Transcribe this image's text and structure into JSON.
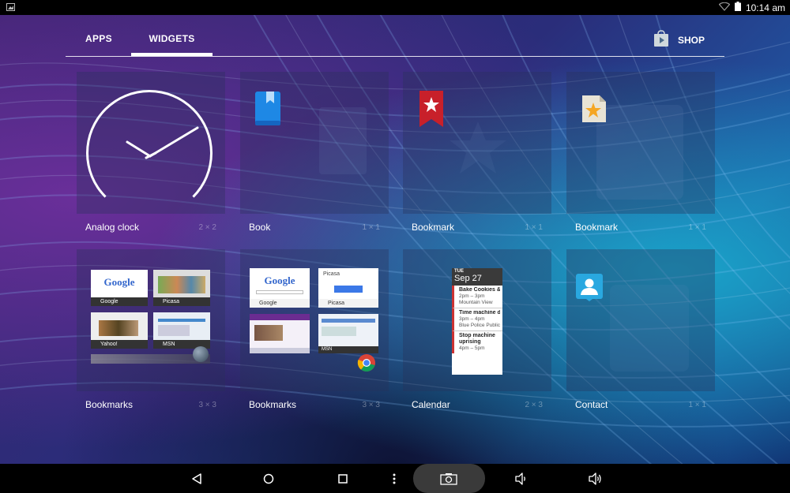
{
  "status_bar": {
    "time": "10:14 am",
    "icons": [
      "image-notification-icon",
      "wifi-icon",
      "battery-icon"
    ]
  },
  "tabs": [
    {
      "label": "APPS",
      "active": false
    },
    {
      "label": "WIDGETS",
      "active": true
    }
  ],
  "shop": {
    "label": "SHOP",
    "icon": "play-store-icon"
  },
  "widgets": [
    {
      "label": "Analog clock",
      "size": "2 × 2",
      "icon": "analog-clock"
    },
    {
      "label": "Book",
      "size": "1 × 1",
      "icon": "book-icon"
    },
    {
      "label": "Bookmark",
      "size": "1 × 1",
      "icon": "bookmark-ribbon-icon"
    },
    {
      "label": "Bookmark",
      "size": "1 × 1",
      "icon": "bookmark-star-icon"
    },
    {
      "label": "Bookmarks",
      "size": "3 × 3",
      "icon": "bookmarks-preview"
    },
    {
      "label": "Bookmarks",
      "size": "3 × 3",
      "icon": "bookmarks-preview"
    },
    {
      "label": "Calendar",
      "size": "2 × 3",
      "icon": "calendar-preview"
    },
    {
      "label": "Contact",
      "size": "1 × 1",
      "icon": "contact-icon"
    }
  ],
  "bookmarks_preview_1": {
    "tiles": [
      "Google",
      "Picasa",
      "Yahoo!",
      "MSN"
    ]
  },
  "bookmarks_preview_2": {
    "tiles": [
      "Google",
      "Picasa",
      "",
      "MSN"
    ],
    "google_logo": "Google",
    "picasa_title": "Picasa"
  },
  "calendar_preview": {
    "day": "TUE",
    "date": "Sep 27",
    "events": [
      {
        "title": "Bake Cookies & Make Ice Cream",
        "time": "2pm – 3pm",
        "place": "Mountain View"
      },
      {
        "title": "Time machine demo for Sergey",
        "time": "3pm – 4pm",
        "place": "Blue Police Public"
      },
      {
        "title": "Stop machine uprising",
        "time": "4pm – 5pm",
        "place": ""
      }
    ]
  },
  "colors": {
    "accent": "#ffffff",
    "tile_bg": "rgba(40,50,90,0.35)",
    "bookmark_red": "#c8202a",
    "book_blue": "#2196f3",
    "contact_blue": "#29a8e0"
  },
  "nav": [
    "back-icon",
    "home-icon",
    "recents-icon",
    "menu-dots-icon",
    "screenshot-icon",
    "volume-down-icon",
    "volume-up-icon"
  ]
}
